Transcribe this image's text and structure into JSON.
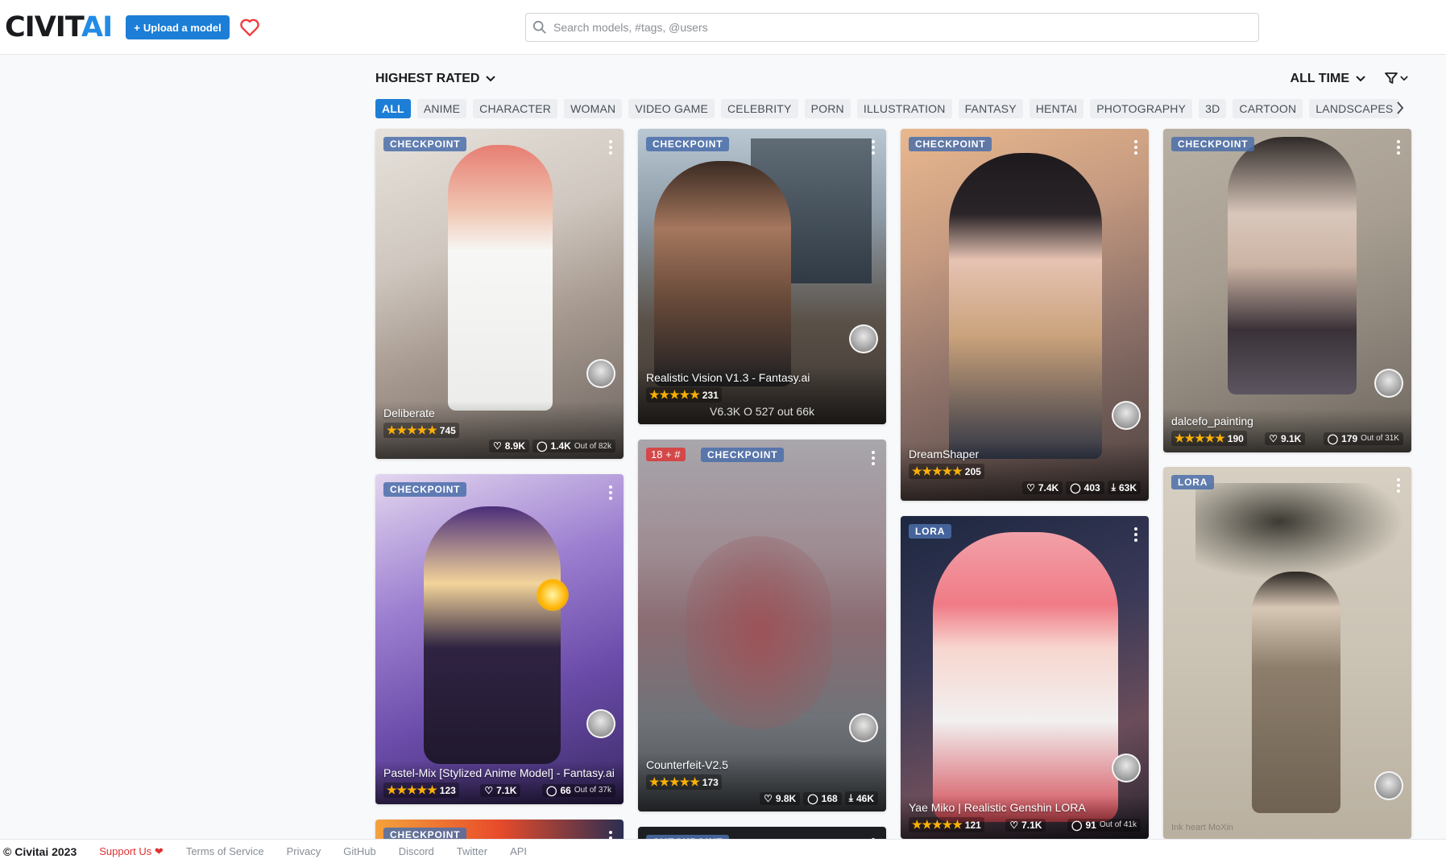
{
  "header": {
    "logo_text": "CIVIT",
    "logo_ai": "AI",
    "upload_label": "Upload a model",
    "search_placeholder": "Search models, #tags, @users"
  },
  "toolbar": {
    "sort_label": "HIGHEST RATED",
    "period_label": "ALL TIME"
  },
  "tags": [
    "ALL",
    "ANIME",
    "CHARACTER",
    "WOMAN",
    "VIDEO GAME",
    "CELEBRITY",
    "PORN",
    "ILLUSTRATION",
    "FANTASY",
    "HENTAI",
    "PHOTOGRAPHY",
    "3D",
    "CARTOON",
    "LANDSCAPES"
  ],
  "active_tag": "ALL",
  "cards": [
    {
      "badge": "CHECKPOINT",
      "title": "Deliberate",
      "rating": "745",
      "likes": "8.9K",
      "comments": "1.4K",
      "extra": "Out of 82k"
    },
    {
      "badge": "CHECKPOINT",
      "title": "Realistic Vision V1.3 - Fantasy.ai",
      "rating": "231",
      "extra_line": "V6.3K O 527 out 66k"
    },
    {
      "badge": "CHECKPOINT",
      "title": "DreamShaper",
      "rating": "205",
      "likes": "7.4K",
      "comments": "403",
      "downloads": "63K"
    },
    {
      "badge": "CHECKPOINT",
      "title": "dalcefo_painting",
      "rating": "190",
      "likes": "9.1K",
      "comments": "179",
      "extra": "Out of 31K"
    },
    {
      "badge": "CHECKPOINT",
      "title": "Pastel-Mix [Stylized Anime Model] - Fantasy.ai",
      "rating": "123",
      "likes": "7.1K",
      "comments": "66",
      "extra": "Out of 37k"
    },
    {
      "badge": "CHECKPOINT",
      "nsfw_badge": "18 + #",
      "title": "Counterfeit-V2.5",
      "rating": "173",
      "likes": "9.8K",
      "comments": "168",
      "downloads": "46K"
    },
    {
      "badge": "LORA",
      "title": "Yae Miko | Realistic Genshin LORA",
      "rating": "121",
      "likes": "7.1K",
      "comments": "91",
      "extra": "Out of 41k"
    },
    {
      "badge": "LORA",
      "caption": "Ink heart MoXin"
    },
    {
      "badge": "CHECKPOINT"
    },
    {
      "badge": "CHECKPOINT"
    }
  ],
  "footer": {
    "brand": "© Civitai 2023",
    "support": "Support Us ❤",
    "links": [
      "Terms of Service",
      "Privacy",
      "GitHub",
      "Discord",
      "Twitter",
      "API"
    ]
  }
}
